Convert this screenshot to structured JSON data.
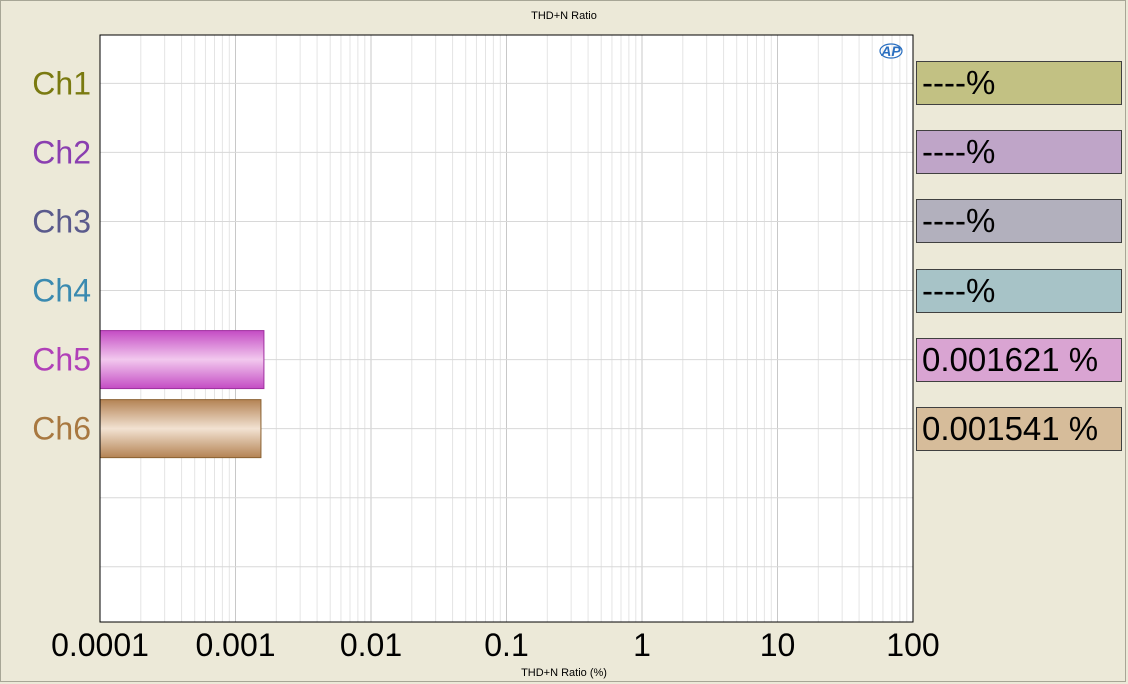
{
  "chart_data": {
    "type": "bar",
    "orientation": "horizontal",
    "title": "THD+N Ratio",
    "xlabel": "THD+N Ratio (%)",
    "x_scale": "log",
    "xlim": [
      0.0001,
      100
    ],
    "x_ticks": [
      "0.0001",
      "0.001",
      "0.01",
      "0.1",
      "1",
      "10",
      "100"
    ],
    "x_tick_values": [
      0.0001,
      0.001,
      0.01,
      0.1,
      1,
      10,
      100
    ],
    "grid": true,
    "categories": [
      "Ch1",
      "Ch2",
      "Ch3",
      "Ch4",
      "Ch5",
      "Ch6"
    ],
    "values": [
      null,
      null,
      null,
      null,
      0.001621,
      0.001541
    ],
    "readouts": [
      "----%",
      "----%",
      "----%",
      "----%",
      "0.001621 %",
      "0.001541 %"
    ],
    "label_colors": [
      "#7a7a10",
      "#8a3fb0",
      "#5a5a8c",
      "#3a8ab0",
      "#b040b8",
      "#a87840"
    ],
    "readout_colors": [
      "#c2c183",
      "#bfa5c8",
      "#b2b0bd",
      "#a7c3c7",
      "#d9a4d2",
      "#d6bc9a"
    ],
    "bar_colors": [
      "#c2c183",
      "#bfa5c8",
      "#b2b0bd",
      "#a7c3c7",
      "#d262cf",
      "#bf9164"
    ]
  },
  "logo": "AP"
}
